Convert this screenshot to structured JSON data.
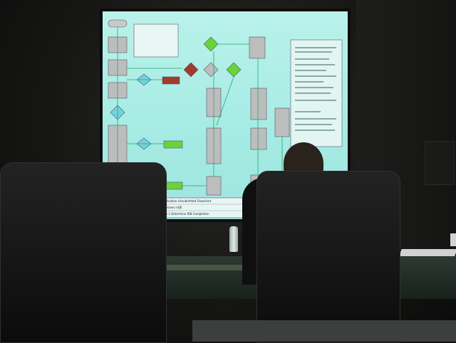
{
  "scene": {
    "description_type": "photo of a meeting room with a projected flowchart"
  },
  "screen_slide": {
    "caption_lines": [
      "Application  Unsubmitted Flowchart",
      "approvers  eQE",
      "Step 1  Determine IRB Completion"
    ]
  },
  "colors": {
    "screen_bg": "#a8ece4",
    "flow_box": "#b8b8b8",
    "flow_accent_green": "#6ad23a",
    "flow_accent_red": "#a33a2a",
    "flow_diamond_cyan": "#6fd3e0"
  }
}
